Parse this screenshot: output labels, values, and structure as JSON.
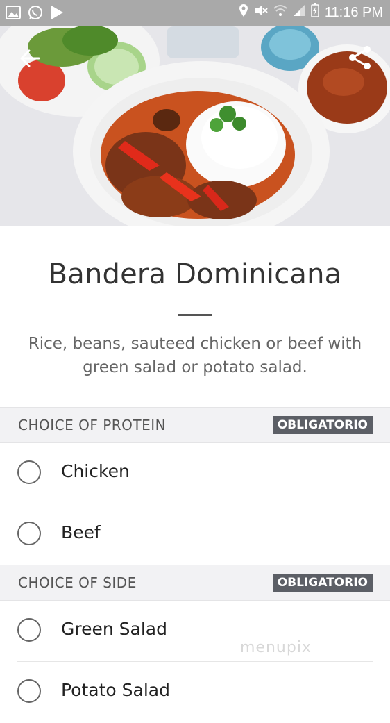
{
  "status_bar": {
    "time": "11:16 PM",
    "left_icons": [
      "gallery-icon",
      "whatsapp-icon",
      "play-icon"
    ],
    "right_icons": [
      "location-icon",
      "mute-icon",
      "wifi-icon",
      "signal-icon",
      "battery-charging-icon"
    ]
  },
  "header": {
    "back_icon": "arrow-left-icon",
    "share_icon": "share-icon"
  },
  "dish": {
    "title": "Bandera Dominicana",
    "description": "Rice, beans, sauteed chicken or beef with green salad or potato salad."
  },
  "sections": [
    {
      "label": "CHOICE OF PROTEIN",
      "badge": "OBLIGATORIO",
      "options": [
        {
          "label": "Chicken",
          "selected": false
        },
        {
          "label": "Beef",
          "selected": false
        }
      ]
    },
    {
      "label": "CHOICE OF SIDE",
      "badge": "OBLIGATORIO",
      "options": [
        {
          "label": "Green Salad",
          "selected": false
        },
        {
          "label": "Potato Salad",
          "selected": false
        }
      ]
    }
  ],
  "watermark": "menupix"
}
